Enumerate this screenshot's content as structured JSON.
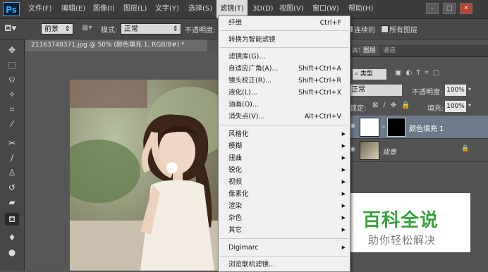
{
  "app": {
    "logo": "Ps"
  },
  "menubar": {
    "items": [
      "文件(F)",
      "编辑(E)",
      "图像(I)",
      "图层(L)",
      "文字(Y)",
      "选择(S)",
      "滤镜(T)",
      "3D(D)",
      "视图(V)",
      "窗口(W)",
      "帮助(H)"
    ],
    "active_index": 6
  },
  "window_controls": {
    "minimize": "–",
    "restore": "□",
    "close": "✕"
  },
  "options_bar": {
    "fill_source": "前景",
    "mode_label": "模式:",
    "mode_value": "正常",
    "opacity_label": "不透明度:",
    "contiguous_label": "连续的",
    "all_layers_label": "所有图层"
  },
  "document": {
    "tab_title": "21163748371.jpg @ 50% (颜色填充 1, RGB/8#) *"
  },
  "filter_menu": {
    "items": [
      {
        "label": "纤维",
        "shortcut": "Ctrl+F"
      },
      {
        "type": "separator"
      },
      {
        "label": "转换为智能滤镜"
      },
      {
        "type": "separator"
      },
      {
        "label": "滤镜库(G)..."
      },
      {
        "label": "自适应广角(A)...",
        "shortcut": "Shift+Ctrl+A"
      },
      {
        "label": "镜头校正(R)...",
        "shortcut": "Shift+Ctrl+R"
      },
      {
        "label": "液化(L)...",
        "shortcut": "Shift+Ctrl+X"
      },
      {
        "label": "油画(O)..."
      },
      {
        "label": "消失点(V)...",
        "shortcut": "Alt+Ctrl+V"
      },
      {
        "type": "separator"
      },
      {
        "label": "风格化",
        "submenu": true
      },
      {
        "label": "模糊",
        "submenu": true
      },
      {
        "label": "扭曲",
        "submenu": true
      },
      {
        "label": "锐化",
        "submenu": true
      },
      {
        "label": "视频",
        "submenu": true
      },
      {
        "label": "像素化",
        "submenu": true
      },
      {
        "label": "渲染",
        "submenu": true
      },
      {
        "label": "杂色",
        "submenu": true
      },
      {
        "label": "其它",
        "submenu": true
      },
      {
        "type": "separator"
      },
      {
        "label": "Digimarc",
        "submenu": true
      },
      {
        "type": "separator"
      },
      {
        "label": "浏览联机滤镜..."
      }
    ]
  },
  "panels": {
    "tabs": [
      "属性",
      "图层",
      "通道"
    ],
    "active_tab": "图层",
    "kind_filter": "类型",
    "blend_mode": "正常",
    "opacity_label": "不透明度:",
    "opacity_value": "100%",
    "lock_label": "锁定:",
    "fill_label": "填充:",
    "fill_value": "100%",
    "layers": [
      {
        "name": "颜色填充 1",
        "selected": true
      },
      {
        "name": "背景",
        "locked": true
      }
    ]
  },
  "watermark": {
    "title": "百科全说",
    "subtitle": "助你轻松解决"
  },
  "colors": {
    "accent": "#31a8ff",
    "menu_bg": "#f0f0f0",
    "ui_dark": "#3c3c3c",
    "watermark_green": "#3aa33f"
  }
}
